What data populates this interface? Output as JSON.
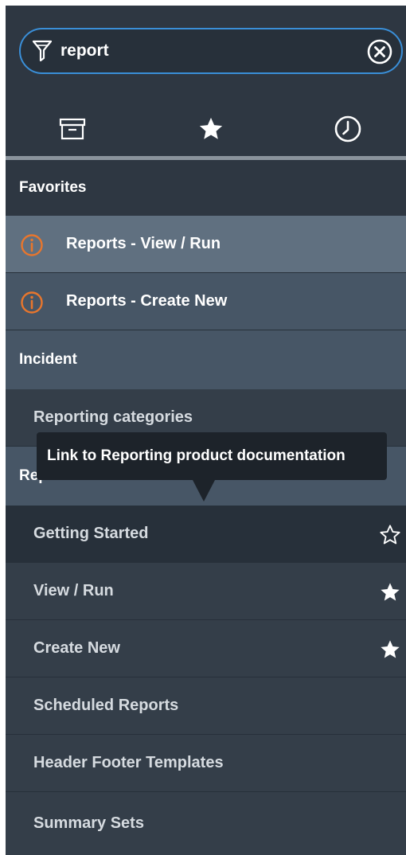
{
  "search": {
    "value": "report"
  },
  "tabs": [
    {
      "icon": "archive-icon"
    },
    {
      "icon": "star-icon"
    },
    {
      "icon": "clock-icon"
    }
  ],
  "sections": {
    "favorites": "Favorites",
    "incident": "Incident",
    "reports": "Reports"
  },
  "favorites": [
    {
      "label": "Reports - View / Run",
      "icon": "info-icon"
    },
    {
      "label": "Reports - Create New",
      "icon": "info-icon"
    }
  ],
  "incident_items": [
    {
      "label": "Reporting categories"
    }
  ],
  "tooltip": {
    "text": "Link to Reporting product documentation"
  },
  "reports_items": [
    {
      "label": "Getting Started",
      "starred": false
    },
    {
      "label": "View / Run",
      "starred": true
    },
    {
      "label": "Create New",
      "starred": true
    },
    {
      "label": "Scheduled Reports"
    },
    {
      "label": "Header Footer Templates"
    },
    {
      "label": "Summary Sets"
    }
  ],
  "colors": {
    "accent": "#3a8fd8",
    "info_orange": "#e8762d",
    "panel": "#2e3742"
  }
}
